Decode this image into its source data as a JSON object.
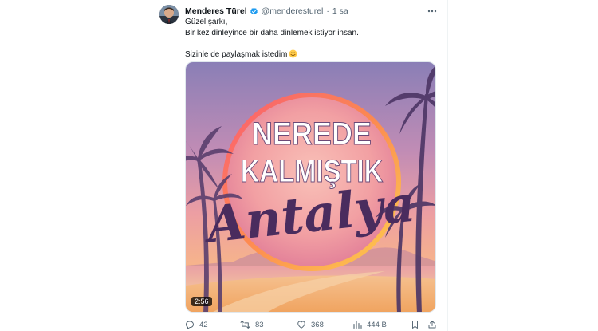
{
  "tweet": {
    "author_name": "Menderes Türel",
    "handle": "@menderesturel",
    "separator": "·",
    "time": "1 sa",
    "text_lines": [
      "Güzel şarkı,",
      "Bir kez dinleyince bir daha dinlemek istiyor insan.",
      "",
      "Sizinle de paylaşmak istedim"
    ],
    "emoji_icon": "smiling-face-emoji"
  },
  "media": {
    "type": "video",
    "title_line1": "NEREDE",
    "title_line2": "KALMIŞTIK",
    "title_script": "Antalya",
    "duration": "2:56"
  },
  "actions": {
    "replies": "42",
    "reposts": "83",
    "likes": "368",
    "views": "444 B"
  },
  "colors": {
    "text_primary": "#0f1419",
    "text_secondary": "#536471",
    "verified": "#1d9bf0"
  }
}
